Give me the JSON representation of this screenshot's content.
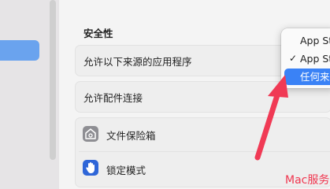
{
  "settings": {
    "section_title": "安全性",
    "allow_apps_label": "允许以下来源的应用程序",
    "accessories_label": "允许配件连接",
    "filevault_label": "文件保险箱",
    "lockdown_label": "锁定模式"
  },
  "dropdown_menu": {
    "items": [
      {
        "label": "App St",
        "checked": false
      },
      {
        "label": "App St",
        "checked": true,
        "check_mark": "✓"
      },
      {
        "label": "任何来",
        "highlighted": true
      }
    ]
  },
  "watermark": {
    "text": "Mac服务"
  },
  "colors": {
    "accent": "#3a82f6",
    "arrow": "#f03a55",
    "lockdown_icon": "#2f66d8",
    "filevault_icon": "#8e8e93"
  },
  "icons": {
    "filevault": "house-lock-icon",
    "lockdown": "hand-raised-icon",
    "arrow": "red-annotation-arrow"
  }
}
